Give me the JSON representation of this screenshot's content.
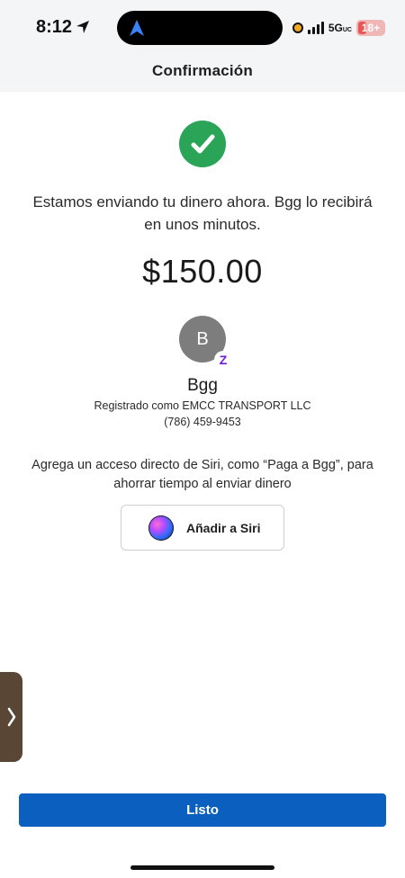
{
  "status_bar": {
    "time": "8:12",
    "network": "5G",
    "network_sub": "UC",
    "battery_badge": "18+",
    "battery_color": "#e85656"
  },
  "nav": {
    "title": "Confirmación"
  },
  "confirmation": {
    "icon": "check-icon",
    "icon_color": "#2aa557",
    "message": "Estamos enviando tu dinero ahora. Bgg lo recibirá en unos minutos.",
    "amount": "$150.00"
  },
  "recipient": {
    "initial": "B",
    "badge_icon": "zelle-icon",
    "badge_glyph": "Z",
    "name": "Bgg",
    "registered_as": "Registrado como EMCC TRANSPORT LLC",
    "phone": "(786) 459-9453"
  },
  "siri": {
    "description": "Agrega un acceso directo de Siri, como “Paga a Bgg”, para ahorrar tiempo al enviar dinero",
    "button_label": "Añadir a Siri"
  },
  "footer": {
    "done_label": "Listo",
    "done_color": "#0a5fbf"
  }
}
